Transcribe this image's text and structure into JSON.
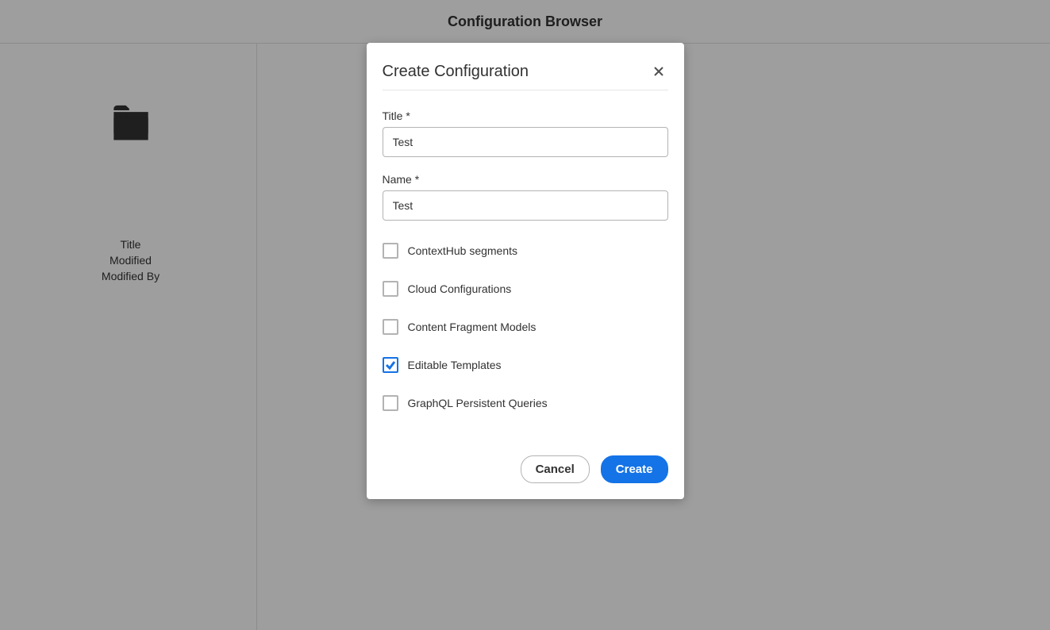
{
  "header": {
    "title": "Configuration Browser"
  },
  "sidebar": {
    "details": [
      "Title",
      "Modified",
      "Modified By"
    ]
  },
  "dialog": {
    "title": "Create Configuration",
    "fields": {
      "title_label": "Title *",
      "title_value": "Test",
      "name_label": "Name *",
      "name_value": "Test"
    },
    "options": [
      {
        "label": "ContextHub segments",
        "checked": false
      },
      {
        "label": "Cloud Configurations",
        "checked": false
      },
      {
        "label": "Content Fragment Models",
        "checked": false
      },
      {
        "label": "Editable Templates",
        "checked": true
      },
      {
        "label": "GraphQL Persistent Queries",
        "checked": false
      }
    ],
    "buttons": {
      "cancel": "Cancel",
      "create": "Create"
    }
  }
}
